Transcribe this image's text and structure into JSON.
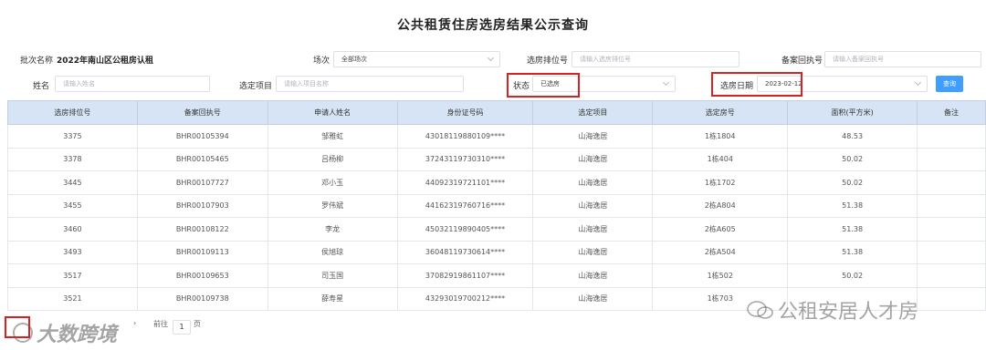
{
  "title": "公共租赁住房选房结果公示查询",
  "filters": {
    "batch_label": "批次名称",
    "batch_value": "2022年南山区公租房认租",
    "venue_label": "场次",
    "venue_value": "全部场次",
    "rank_label": "选房排位号",
    "rank_placeholder": "请输入选房排位号",
    "receipt_label": "备案回执号",
    "receipt_placeholder": "请输入备案回执号",
    "name_label": "姓名",
    "name_placeholder": "请输入姓名",
    "project_label": "选定项目",
    "project_placeholder": "请输入项目名称",
    "status_label": "状态",
    "status_value": "已选房",
    "date_label": "选房日期",
    "date_value": "2023-02-12",
    "query_label": "查询"
  },
  "table": {
    "headers": [
      "选房排位号",
      "备案回执号",
      "申请人姓名",
      "身份证号码",
      "选定项目",
      "选定房号",
      "面积(平方米)",
      "备注"
    ],
    "rows": [
      [
        "3375",
        "BHR00105394",
        "邹雅虹",
        "43018119880109****",
        "山海逸居",
        "1栋1804",
        "48.53",
        ""
      ],
      [
        "3378",
        "BHR00105465",
        "吕杨柳",
        "37243119730310****",
        "山海逸居",
        "1栋404",
        "50.02",
        ""
      ],
      [
        "3445",
        "BHR00107727",
        "邓小玉",
        "44092319721101****",
        "山海逸居",
        "1栋1702",
        "50.02",
        ""
      ],
      [
        "3455",
        "BHR00107903",
        "罗伟斌",
        "44162319760716****",
        "山海逸居",
        "2栋A804",
        "51.38",
        ""
      ],
      [
        "3460",
        "BHR00108122",
        "李龙",
        "45032119890405****",
        "山海逸居",
        "2栋A605",
        "51.38",
        ""
      ],
      [
        "3493",
        "BHR00109113",
        "侯旭琼",
        "36048119730614****",
        "山海逸居",
        "2栋A504",
        "51.38",
        ""
      ],
      [
        "3517",
        "BHR00109653",
        "司玉国",
        "37082919861107****",
        "山海逸居",
        "1栋502",
        "50.02",
        ""
      ],
      [
        "3521",
        "BHR00109738",
        "薛寿星",
        "43293019700212****",
        "山海逸居",
        "1栋703",
        "",
        ""
      ]
    ]
  },
  "pager": {
    "goto_label": "前往",
    "page": "1",
    "page_suffix": "页",
    "next": "›"
  },
  "watermarks": {
    "left": "大数跨境",
    "right": "公租安居人才房"
  }
}
